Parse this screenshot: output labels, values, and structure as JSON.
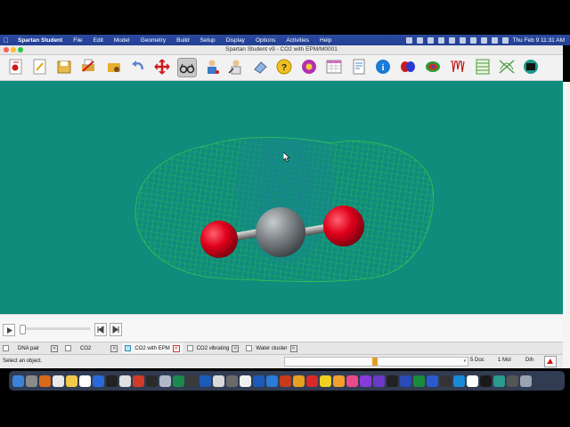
{
  "menubar": {
    "app_name": "Spartan Student",
    "items": [
      "File",
      "Edit",
      "Model",
      "Geometry",
      "Build",
      "Setup",
      "Display",
      "Options",
      "Activities",
      "Help"
    ],
    "clock": "Thu Feb 9  11:31 AM"
  },
  "window": {
    "title": "Spartan Student v9 - CO2 with EPM/M0001"
  },
  "toolbar": {
    "icons": [
      "new-molecule",
      "edit",
      "save",
      "print",
      "open-folder",
      "undo",
      "translate",
      "glasses-view",
      "build-person",
      "expert-person",
      "eraser",
      "help-question",
      "ring",
      "spreadsheet",
      "document",
      "info",
      "orbital",
      "density-surface",
      "spectrum",
      "table",
      "graph",
      "terminal"
    ]
  },
  "tabs": [
    {
      "label": "DNA pair",
      "active": false
    },
    {
      "label": "CO2",
      "active": false
    },
    {
      "label": "CO2 with EPM",
      "active": true
    },
    {
      "label": "CO2 vibrating",
      "active": false
    },
    {
      "label": "Water cluster",
      "active": false
    }
  ],
  "status": {
    "message": "Select an object.",
    "docs": "5 Doc",
    "mol": "1 Mol",
    "mode": "Dih"
  },
  "colors": {
    "viewport_bg": "#108c7c",
    "oxygen": "#e0001a",
    "carbon": "#7c8285",
    "mesh_green": "#3fd24a",
    "mesh_blue": "#2d5fd6",
    "active_tab_close": "#dd3333"
  }
}
